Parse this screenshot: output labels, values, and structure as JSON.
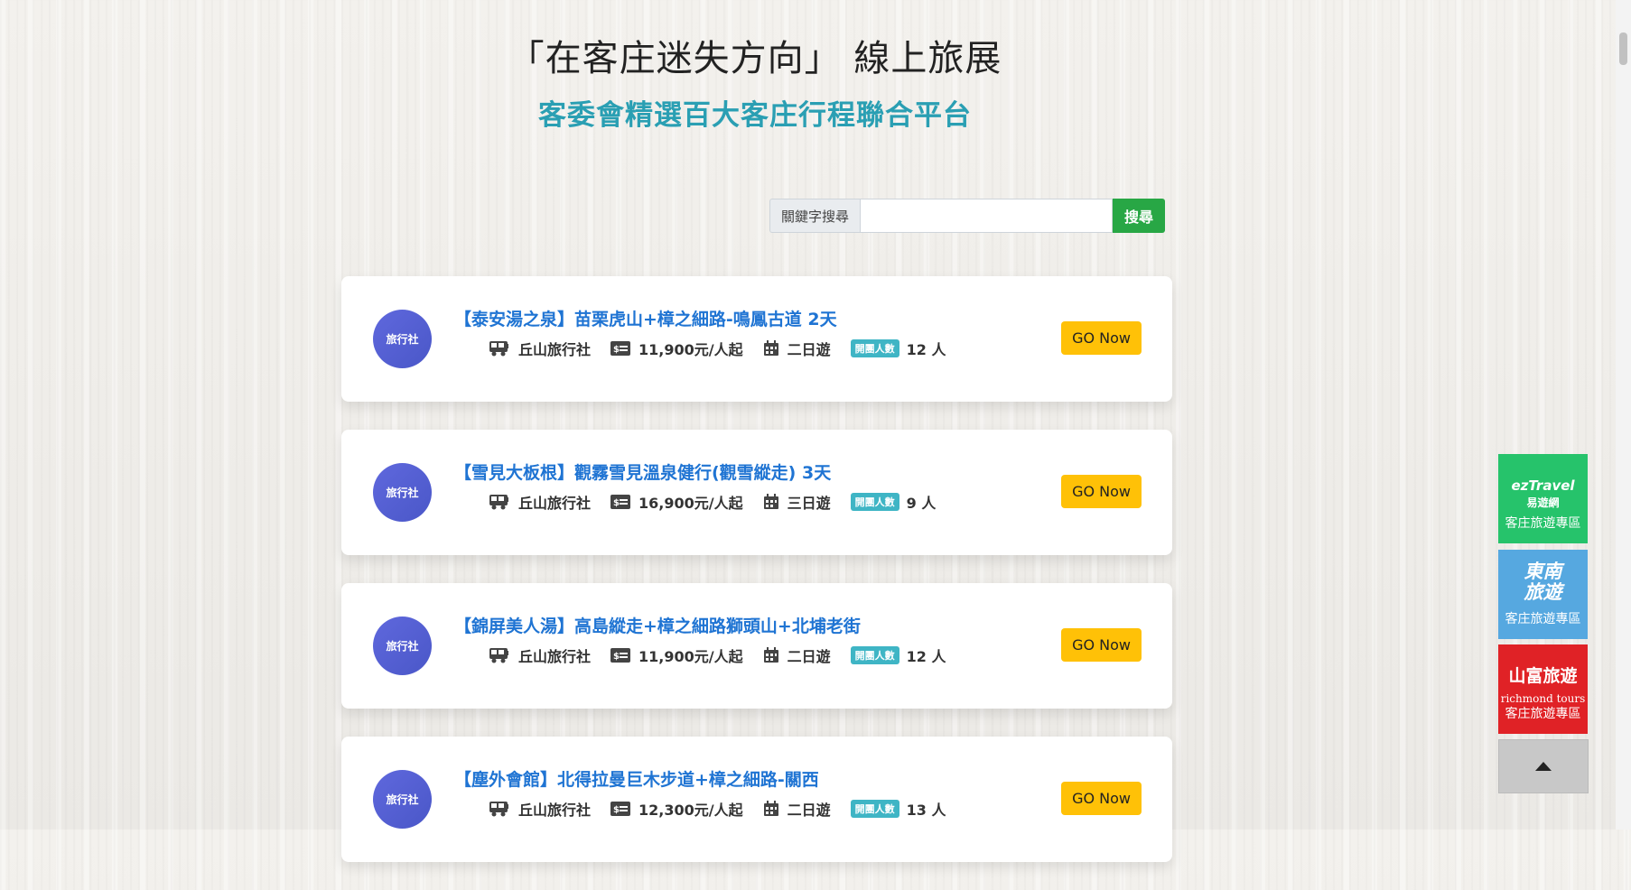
{
  "header": {
    "title": "「在客庄迷失方向」 線上旅展",
    "subtitle": "客委會精選百大客庄行程聯合平台"
  },
  "search": {
    "label": "關鍵字搜尋",
    "value": "",
    "button": "搜尋"
  },
  "tours": [
    {
      "badge": "旅行社",
      "title": "【泰安湯之泉】苗栗虎山+樟之細路-鳴鳳古道 2天",
      "agency": "丘山旅行社",
      "price": "11,900元/人起",
      "duration": "二日遊",
      "tag": "開團人數",
      "people": "12 人",
      "button": "GO Now"
    },
    {
      "badge": "旅行社",
      "title": "【雪見大板根】觀霧雪見溫泉健行(觀雪縱走) 3天",
      "agency": "丘山旅行社",
      "price": "16,900元/人起",
      "duration": "三日遊",
      "tag": "開團人數",
      "people": "9 人",
      "button": "GO Now"
    },
    {
      "badge": "旅行社",
      "title": "【錦屏美人湯】高島縱走+樟之細路獅頭山+北埔老街",
      "agency": "丘山旅行社",
      "price": "11,900元/人起",
      "duration": "二日遊",
      "tag": "開團人數",
      "people": "12 人",
      "button": "GO Now"
    },
    {
      "badge": "旅行社",
      "title": "【塵外會館】北得拉曼巨木步道+樟之細路-關西",
      "agency": "丘山旅行社",
      "price": "12,300元/人起",
      "duration": "二日遊",
      "tag": "開團人數",
      "people": "13 人",
      "button": "GO Now"
    }
  ],
  "sidebar": {
    "ez": {
      "logo": "ezTravel",
      "logo_cn": "易遊網",
      "sub": "客庄旅遊專區"
    },
    "dn": {
      "logo1": "東南",
      "logo2": "旅遊",
      "sub": "客庄旅遊專區"
    },
    "sf": {
      "logo": "山富旅遊",
      "logo_en": "richmond tours",
      "sub": "客庄旅遊專區"
    }
  },
  "colors": {
    "title_blue": "#1f74d3",
    "subtitle_teal": "#2a9fb3",
    "go_yellow": "#ffc107",
    "search_green": "#28a745"
  }
}
